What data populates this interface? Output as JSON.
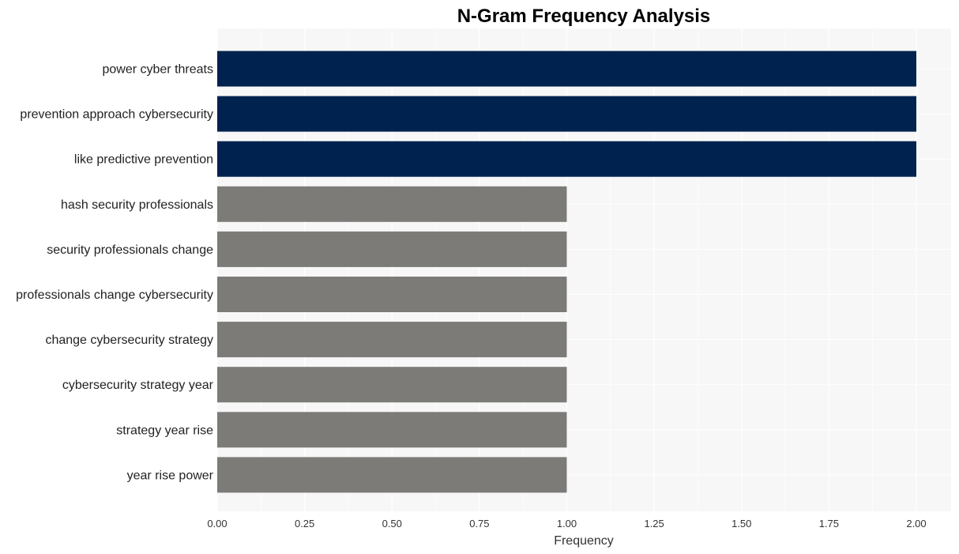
{
  "chart_data": {
    "type": "bar",
    "orientation": "horizontal",
    "title": "N-Gram Frequency Analysis",
    "xlabel": "Frequency",
    "ylabel": "",
    "xlim": [
      0,
      2.1
    ],
    "xticks": [
      0,
      0.25,
      0.5,
      0.75,
      1.0,
      1.25,
      1.5,
      1.75,
      2.0
    ],
    "xtick_labels": [
      "0.00",
      "0.25",
      "0.50",
      "0.75",
      "1.00",
      "1.25",
      "1.50",
      "1.75",
      "2.00"
    ],
    "grid": true,
    "categories": [
      "power cyber threats",
      "prevention approach cybersecurity",
      "like predictive prevention",
      "hash security professionals",
      "security professionals change",
      "professionals change cybersecurity",
      "change cybersecurity strategy",
      "cybersecurity strategy year",
      "strategy year rise",
      "year rise power"
    ],
    "values": [
      2,
      2,
      2,
      1,
      1,
      1,
      1,
      1,
      1,
      1
    ],
    "colors": {
      "highlight": "#00224e",
      "default": "#7c7b78",
      "plot_background": "#f7f7f7",
      "grid": "#ffffff"
    }
  }
}
